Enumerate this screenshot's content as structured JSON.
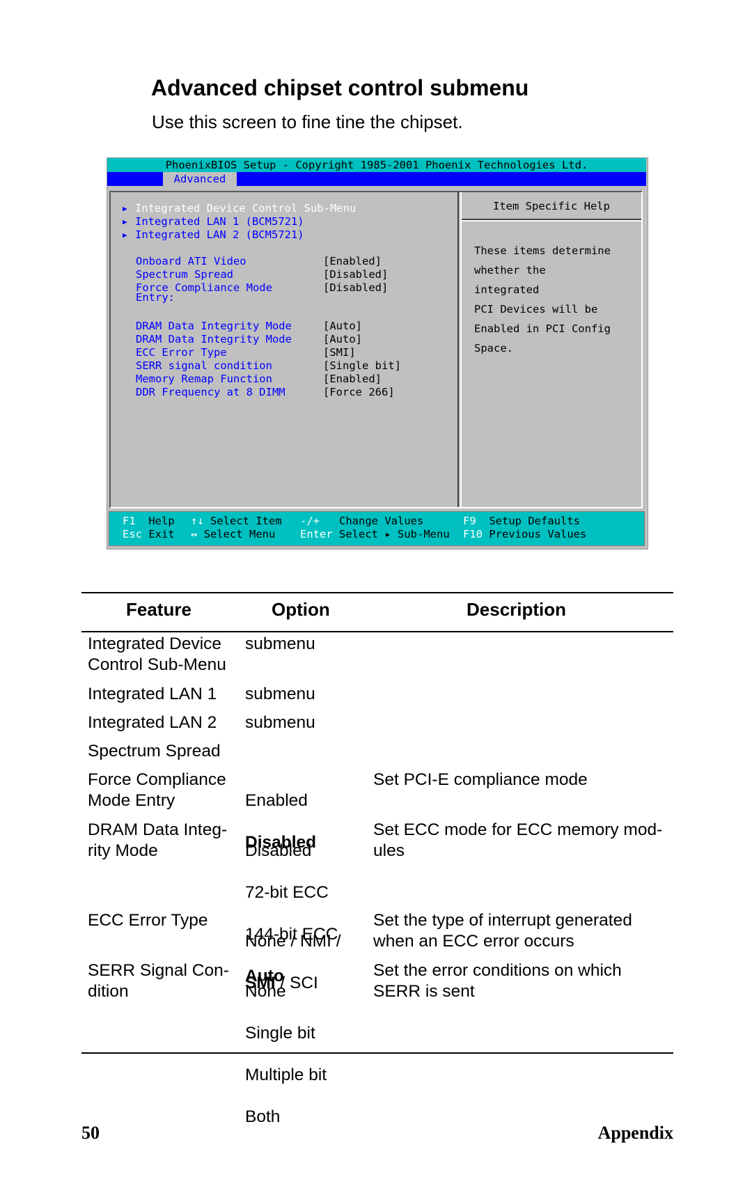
{
  "page": {
    "title": "Advanced chipset control submenu",
    "intro": "Use this screen to fine tine the chipset."
  },
  "bios": {
    "title_bar": "PhoenixBIOS Setup - Copyright 1985-2001 Phoenix Technologies Ltd.",
    "active_tab": "Advanced",
    "submenus": [
      {
        "label": "Integrated Device Control Sub-Menu",
        "selected": true
      },
      {
        "label": "Integrated LAN 1 (BCM5721)",
        "selected": false
      },
      {
        "label": "Integrated LAN 2 (BCM5721)",
        "selected": false
      }
    ],
    "settings": [
      {
        "label": "Onboard ATI Video",
        "value": "[Enabled]"
      },
      {
        "label": "Spectrum Spread",
        "value": "[Disabled]"
      },
      {
        "label": "Force Compliance Mode",
        "label2": "Entry:",
        "value": "[Disabled]"
      },
      {
        "label": "DRAM Data Integrity Mode",
        "value": "[Auto]"
      },
      {
        "label": "DRAM Data Integrity Mode",
        "value": "[Auto]"
      },
      {
        "label": "ECC Error Type",
        "value": "[SMI]"
      },
      {
        "label": "SERR signal condition",
        "value": "[Single bit]"
      },
      {
        "label": "Memory Remap Function",
        "value": "[Enabled]"
      },
      {
        "label": "DDR Frequency at 8 DIMM",
        "value": "[Force 266]"
      }
    ],
    "help": {
      "header": "Item Specific Help",
      "lines": [
        "These items determine",
        "whether the",
        "integrated",
        "PCI Devices will be",
        "Enabled in PCI Config",
        "Space."
      ]
    },
    "footer": {
      "row1": [
        {
          "key": "F1",
          "action": "Help"
        },
        {
          "key": "↑↓",
          "action": "Select Item"
        },
        {
          "key": "-/+",
          "action": "Change Values"
        },
        {
          "key": "F9",
          "action": "Setup Defaults"
        }
      ],
      "row2": [
        {
          "key": "Esc",
          "action": "Exit"
        },
        {
          "key": "↔",
          "action": "Select Menu"
        },
        {
          "key": "Enter",
          "action": "Select ▸ Sub-Menu"
        },
        {
          "key": "F10",
          "action": "Previous Values"
        }
      ]
    },
    "colors": {
      "title_bg": "#00c0c0",
      "menubar_bg": "#0000ff",
      "panel_bg": "#c0c0c0",
      "item_text": "#0000ff",
      "selected_text": "#ffffff"
    }
  },
  "table": {
    "headers": [
      "Feature",
      "Option",
      "Description"
    ],
    "rows": [
      {
        "feature": "Integrated Device\nControl Sub-Menu",
        "options": [
          {
            "text": "submenu"
          }
        ],
        "description": ""
      },
      {
        "feature": "Integrated LAN 1",
        "options": [
          {
            "text": "submenu"
          }
        ],
        "description": ""
      },
      {
        "feature": "Integrated LAN 2",
        "options": [
          {
            "text": "submenu"
          }
        ],
        "description": ""
      },
      {
        "feature": "Spectrum Spread",
        "options": [],
        "description": ""
      },
      {
        "feature": "Force Compliance\nMode Entry",
        "options": [
          {
            "text": "Enabled"
          },
          {
            "text": "Disabled",
            "default": true
          }
        ],
        "description": "Set PCI-E compliance mode"
      },
      {
        "feature": "DRAM Data Integ-\nrity Mode",
        "options": [
          {
            "text": "Disabled"
          },
          {
            "text": "72-bit ECC"
          },
          {
            "text": "144-bit ECC"
          },
          {
            "text": "Auto",
            "default": true
          }
        ],
        "description": "Set ECC mode for ECC memory mod-\nules"
      },
      {
        "feature": "ECC Error Type",
        "options_inline": [
          "None / NMI /",
          "SMI",
          " / SCI"
        ],
        "description": "Set the type of interrupt generated\nwhen an ECC error occurs"
      },
      {
        "feature": "SERR Signal Con-\ndition",
        "options": [
          {
            "text": "None"
          },
          {
            "text": "Single bit"
          },
          {
            "text": "Multiple bit"
          },
          {
            "text": "Both"
          }
        ],
        "description": "Set the error conditions on which\nSERR is sent"
      }
    ]
  },
  "footer": {
    "page_number": "50",
    "section": "Appendix"
  }
}
